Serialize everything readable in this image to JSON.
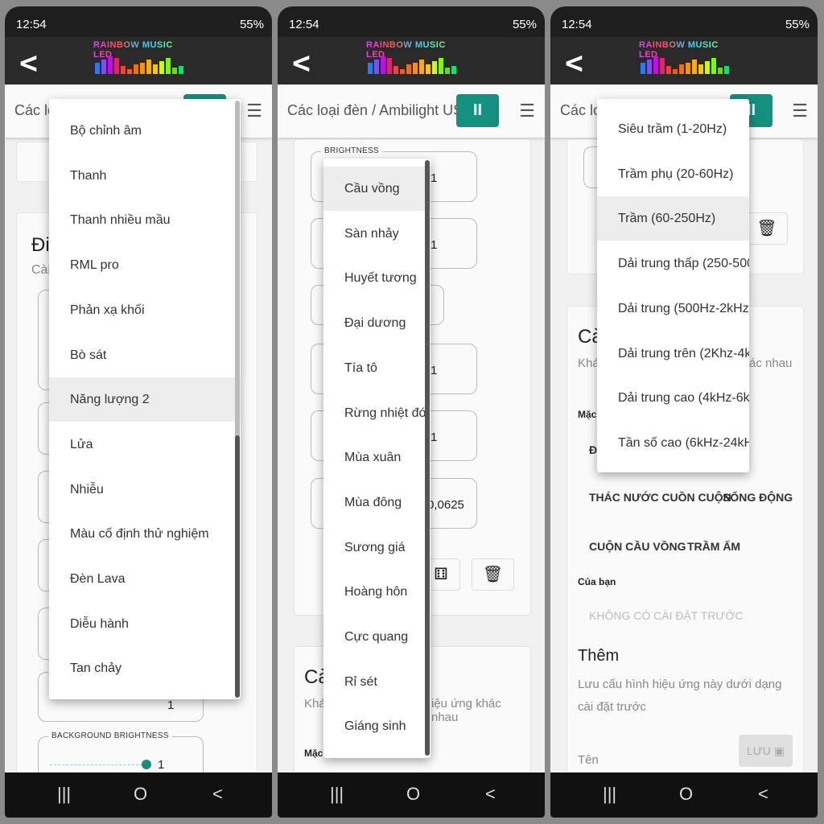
{
  "status": {
    "time": "12:54",
    "battery": "55%",
    "icons": [
      "gallery-icon",
      "youtube-icon",
      "zalo-icon",
      "wifi-icon",
      "signal-icon",
      "battery-icon"
    ]
  },
  "app": {
    "logo_text": "RAINBOW MUSIC LED",
    "back_icon": "chevron-left-icon"
  },
  "colors": {
    "accent": "#13907f",
    "appbar": "#2a2a2a"
  },
  "nav": {
    "recents": "|||",
    "home": "O",
    "back": "<"
  },
  "phone1": {
    "title": "Các loạ",
    "card2_heading": "Đi",
    "card2_sub": "Cài",
    "bg_brightness_label": "BACKGROUND BRIGHTNESS",
    "bg_brightness_value": "1",
    "slider_value": "1",
    "menu": {
      "items": [
        "Bộ chỉnh âm",
        "Thanh",
        "Thanh nhiều mầu",
        "RML pro",
        "Phản xạ khối",
        "Bò sát",
        "Năng lượng 2",
        "Lửa",
        "Nhiễu",
        "Màu cố định thử nghiệm",
        "Đèn Lava",
        "Diễu hành",
        "Tan chảy"
      ],
      "highlighted": "Năng lượng 2"
    }
  },
  "phone2": {
    "title": "Các loại đèn / Ambilight USB",
    "pause_icon": "pause-icon",
    "brightness_label": "BRIGHTNESS",
    "field_values": [
      "1",
      "1",
      "",
      "1",
      "1",
      "0,0625"
    ],
    "card2_heading": "Cà",
    "card2_sub_left": "Khá",
    "card2_sub_right": "iệu ứng khác nhau",
    "card2_default": "Mặc",
    "menu": {
      "items": [
        "Cầu vồng",
        "Sàn nhảy",
        "Huyết tương",
        "Đại dương",
        "Tía tô",
        "Rừng nhiệt đới",
        "Mùa xuân",
        "Mùa đông",
        "Sương giá",
        "Hoàng hôn",
        "Cực quang",
        "Rỉ sét",
        "Giáng sinh"
      ],
      "highlighted": "Cầu vồng"
    }
  },
  "phone3": {
    "title": "Các loạ",
    "card2_heading": "Cà",
    "card2_sub_left": "Khá",
    "card2_sub_right": "ác nhau",
    "default_label": "Mặc",
    "default_first": "ĐA",
    "presets": [
      "THÁC NƯỚC CUỒN CUỘN",
      "SỐNG ĐỘNG",
      "CUỘN CẦU VỒNG",
      "TRẦM ẤM"
    ],
    "yours_label": "Của bạn",
    "no_presets": "KHÔNG CÓ CÀI ĐẶT TRƯỚC",
    "add_heading": "Thêm",
    "add_desc": "Lưu cấu hình hiệu ứng này dưới dạng cài đặt trước",
    "name_label": "Tên",
    "save_label": "LƯU",
    "menu": {
      "items": [
        "Siêu trầm (1-20Hz)",
        "Trầm phụ (20-60Hz)",
        "Trầm (60-250Hz)",
        "Dải trung thấp (250-500Hz)",
        "Dải trung (500Hz-2kHz)",
        "Dải trung trên (2Khz-4kHz)",
        "Dải trung cao (4kHz-6kHz)",
        "Tần số cao (6kHz-24kHz)"
      ],
      "highlighted": "Trầm (60-250Hz)"
    }
  }
}
